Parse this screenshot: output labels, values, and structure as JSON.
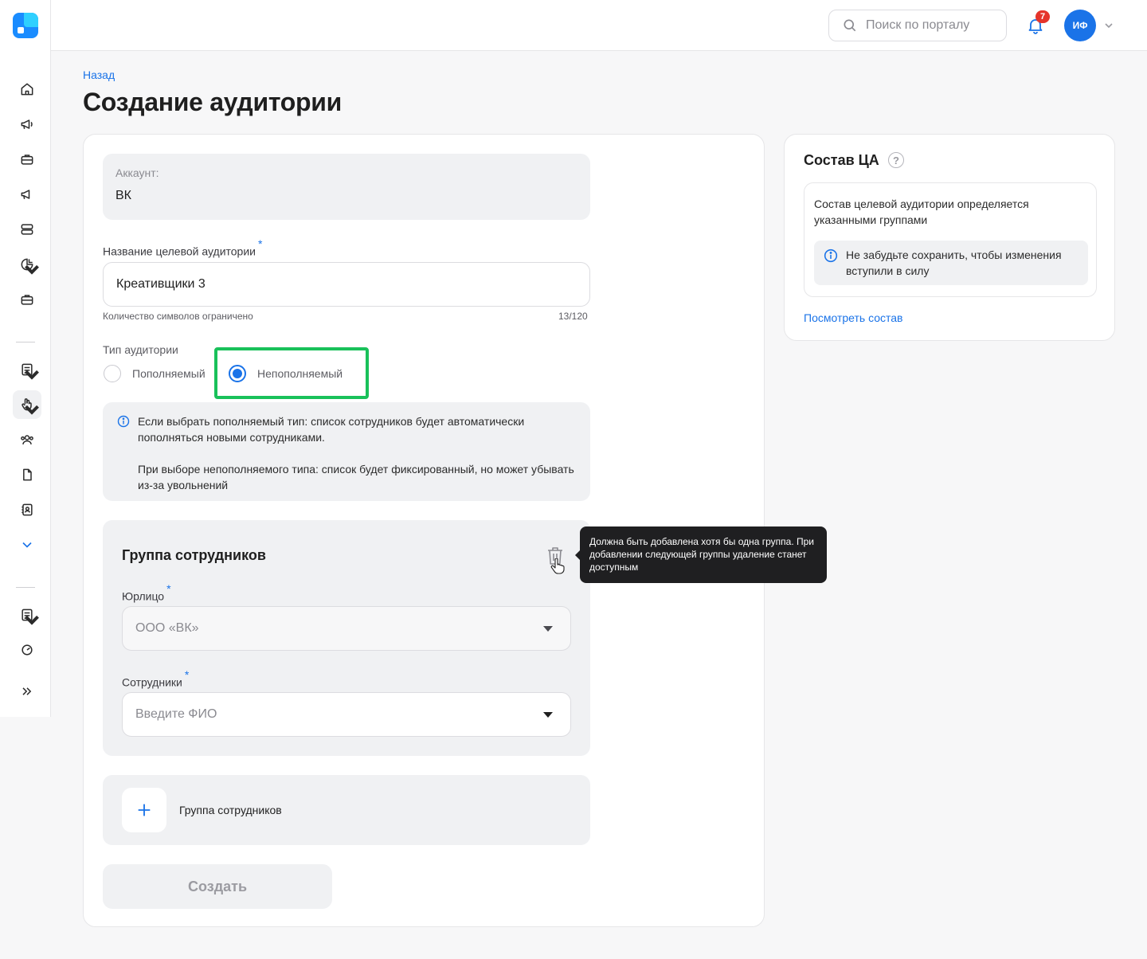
{
  "header": {
    "search_placeholder": "Поиск по порталу",
    "notification_count": "7",
    "avatar_initials": "ИФ"
  },
  "page": {
    "back_label": "Назад",
    "title": "Создание аудитории"
  },
  "form": {
    "account": {
      "label": "Аккаунт:",
      "value": "ВК"
    },
    "name": {
      "label": "Название целевой аудитории",
      "required_mark": "*",
      "value": "Креативщики 3",
      "hint": "Количество символов ограничено",
      "counter": "13/120"
    },
    "audience_type": {
      "label": "Тип аудитории",
      "options": [
        {
          "label": "Пополняемый",
          "selected": false
        },
        {
          "label": "Непополняемый",
          "selected": true
        }
      ]
    },
    "info": {
      "line1": "Если выбрать пополняемый тип: список сотрудников будет автоматически пополняться новыми сотрудниками.",
      "line2": "При выборе непополняемого типа: список будет фиксированный, но может убывать из-за увольнений"
    },
    "group": {
      "title": "Группа сотрудников",
      "legal_entity_label": "Юрлицо",
      "legal_entity_value": "ООО «ВК»",
      "employees_label": "Сотрудники",
      "employees_placeholder": "Введите ФИО",
      "required_mark": "*"
    },
    "add_group_label": "Группа сотрудников",
    "create_label": "Создать"
  },
  "tooltip": {
    "text": "Должна быть добавлена хотя бы одна группа. При добавлении следующей группы удаление станет доступным"
  },
  "side": {
    "title": "Состав ЦА",
    "help": "?",
    "description": "Состав целевой аудитории определяется указанными группами",
    "note": "Не забудьте сохранить, чтобы изменения вступили в силу",
    "link": "Посмотреть состав"
  },
  "colors": {
    "accent": "#1a73e8",
    "highlight": "#19c15a",
    "badge": "#e5342b"
  }
}
